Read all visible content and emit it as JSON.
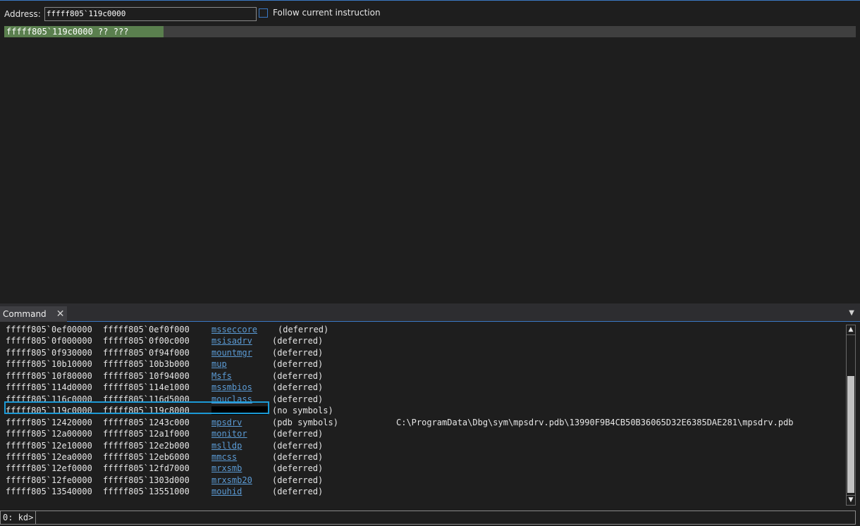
{
  "disassembly": {
    "address_label": "Address:",
    "address_value": "fffff805`119c0000",
    "follow_label": "Follow current instruction",
    "follow_checked": false,
    "current_line": "fffff805`119c0000 ?? ???"
  },
  "command": {
    "tab_label": "Command",
    "close_icon": "close-icon",
    "menu_icon": "caret-down-icon",
    "rows": [
      {
        "start": "fffff805`0ef00000",
        "end": "fffff805`0ef0f000",
        "name": "msseccore",
        "status": "(deferred)"
      },
      {
        "start": "fffff805`0f000000",
        "end": "fffff805`0f00c000",
        "name": "msisadrv",
        "status": "(deferred)"
      },
      {
        "start": "fffff805`0f930000",
        "end": "fffff805`0f94f000",
        "name": "mountmgr",
        "status": "(deferred)"
      },
      {
        "start": "fffff805`10b10000",
        "end": "fffff805`10b3b000",
        "name": "mup",
        "status": "(deferred)"
      },
      {
        "start": "fffff805`10f80000",
        "end": "fffff805`10f94000",
        "name": "Msfs",
        "status": "(deferred)"
      },
      {
        "start": "fffff805`114d0000",
        "end": "fffff805`114e1000",
        "name": "mssmbios",
        "status": "(deferred)"
      },
      {
        "start": "fffff805`116c0000",
        "end": "fffff805`116d5000",
        "name": "mouclass",
        "status": "(deferred)"
      },
      {
        "start": "fffff805`119c0000",
        "end": "fffff805`119c8000",
        "name": "",
        "status": "(no symbols)"
      },
      {
        "start": "fffff805`12420000",
        "end": "fffff805`1243c000",
        "name": "mpsdrv",
        "status": "(pdb symbols)",
        "path": "C:\\ProgramData\\Dbg\\sym\\mpsdrv.pdb\\13990F9B4CB50B36065D32E6385DAE281\\mpsdrv.pdb"
      },
      {
        "start": "fffff805`12a00000",
        "end": "fffff805`12a1f000",
        "name": "monitor",
        "status": "(deferred)"
      },
      {
        "start": "fffff805`12e10000",
        "end": "fffff805`12e2b000",
        "name": "mslldp",
        "status": "(deferred)"
      },
      {
        "start": "fffff805`12ea0000",
        "end": "fffff805`12eb6000",
        "name": "mmcss",
        "status": "(deferred)"
      },
      {
        "start": "fffff805`12ef0000",
        "end": "fffff805`12fd7000",
        "name": "mrxsmb",
        "status": "(deferred)"
      },
      {
        "start": "fffff805`12fe0000",
        "end": "fffff805`1303d000",
        "name": "mrxsmb20",
        "status": "(deferred)"
      },
      {
        "start": "fffff805`13540000",
        "end": "fffff805`13551000",
        "name": "mouhid",
        "status": "(deferred)"
      }
    ],
    "prompt": "0: kd>",
    "input_value": ""
  },
  "colors": {
    "accent": "#3a78c3",
    "link": "#5b9bd5",
    "highlight": "#5a7f4e",
    "selection_box": "#1c9ad6"
  }
}
